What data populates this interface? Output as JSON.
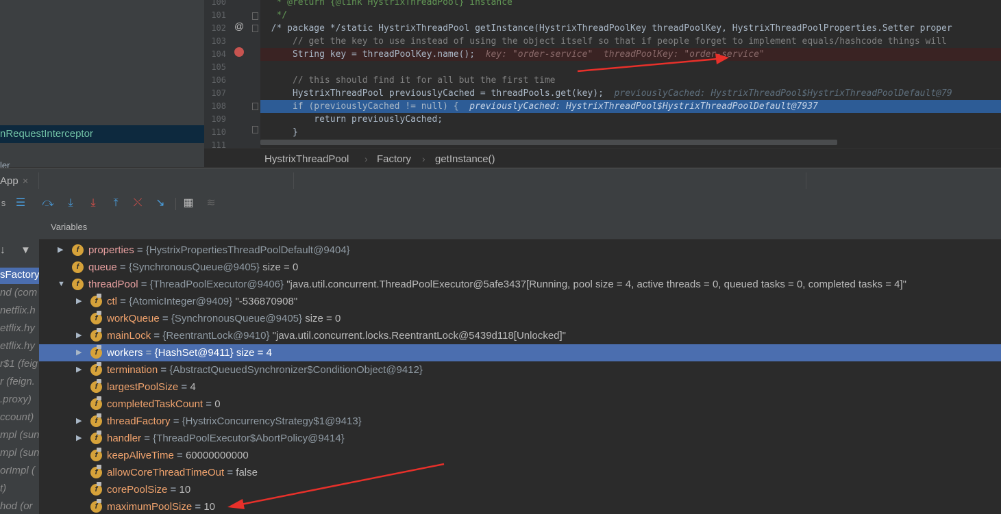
{
  "project_pane": {
    "selected_item": "nRequestInterceptor",
    "cut_item": "ler"
  },
  "editor": {
    "lines": [
      {
        "num": "100",
        "text": " * @return {@link HystrixThreadPool} instance"
      },
      {
        "num": "101",
        "text": " */"
      },
      {
        "num": "102",
        "text": "/* package */static HystrixThreadPool getInstance(HystrixThreadPoolKey threadPoolKey, HystrixThreadPoolProperties.Setter proper"
      },
      {
        "num": "103",
        "text": "    // get the key to use instead of using the object itself so that if people forget to implement equals/hashcode things will"
      },
      {
        "num": "104",
        "text": "    String key = threadPoolKey.name();",
        "hint": "key: \"order-service\"  threadPoolKey: \"order-service\""
      },
      {
        "num": "105",
        "text": ""
      },
      {
        "num": "106",
        "text": "    // this should find it for all but the first time"
      },
      {
        "num": "107",
        "text": "    HystrixThreadPool previouslyCached = threadPools.get(key);",
        "hint": "previouslyCached: HystrixThreadPool$HystrixThreadPoolDefault@79"
      },
      {
        "num": "108",
        "text": "    if (previouslyCached != null) {",
        "hint": "previouslyCached: HystrixThreadPool$HystrixThreadPoolDefault@7937"
      },
      {
        "num": "109",
        "text": "        return previouslyCached;"
      },
      {
        "num": "110",
        "text": "    }"
      },
      {
        "num": "111",
        "text": ""
      }
    ],
    "gutter_marks": {
      "at_symbol": "@"
    }
  },
  "breadcrumb": [
    "HystrixThreadPool",
    "Factory",
    "getInstance()"
  ],
  "debug": {
    "tab_label": "App",
    "tab_close": "×",
    "variables_header": "Variables",
    "left_frames": [
      "sFactory",
      "nd (com",
      "netflix.h",
      "etflix.hy",
      "etflix.hy",
      "r$1 (feig",
      "r (feign.",
      ".proxy)",
      "ccount)",
      "mpl (sun",
      "mpl (sun.",
      "orImpl (",
      "t)",
      "hod (or"
    ],
    "variables": [
      {
        "indent": 0,
        "expand": "▶",
        "name": "properties",
        "type": "{HystrixPropertiesThreadPoolDefault@9404}",
        "value": ""
      },
      {
        "indent": 0,
        "expand": "",
        "name": "queue",
        "type": "{SynchronousQueue@9405}",
        "value": " size = 0"
      },
      {
        "indent": 0,
        "expand": "▼",
        "name": "threadPool",
        "type": "{ThreadPoolExecutor@9406}",
        "value": "\"java.util.concurrent.ThreadPoolExecutor@5afe3437[Running, pool size = 4, active threads = 0, queued tasks = 0, completed tasks = 4]\""
      },
      {
        "indent": 1,
        "expand": "▶",
        "name": "ctl",
        "type": "{AtomicInteger@9409}",
        "value": "\"-536870908\""
      },
      {
        "indent": 1,
        "expand": "",
        "name": "workQueue",
        "type": "{SynchronousQueue@9405}",
        "value": " size = 0"
      },
      {
        "indent": 1,
        "expand": "▶",
        "name": "mainLock",
        "type": "{ReentrantLock@9410}",
        "value": "\"java.util.concurrent.locks.ReentrantLock@5439d118[Unlocked]\""
      },
      {
        "indent": 1,
        "expand": "▶",
        "name": "workers",
        "type": "{HashSet@9411}",
        "value": " size = 4",
        "selected": true
      },
      {
        "indent": 1,
        "expand": "▶",
        "name": "termination",
        "type": "{AbstractQueuedSynchronizer$ConditionObject@9412}",
        "value": ""
      },
      {
        "indent": 1,
        "expand": "",
        "name": "largestPoolSize",
        "type": "",
        "value": "4"
      },
      {
        "indent": 1,
        "expand": "",
        "name": "completedTaskCount",
        "type": "",
        "value": "0"
      },
      {
        "indent": 1,
        "expand": "▶",
        "name": "threadFactory",
        "type": "{HystrixConcurrencyStrategy$1@9413}",
        "value": ""
      },
      {
        "indent": 1,
        "expand": "▶",
        "name": "handler",
        "type": "{ThreadPoolExecutor$AbortPolicy@9414}",
        "value": ""
      },
      {
        "indent": 1,
        "expand": "",
        "name": "keepAliveTime",
        "type": "",
        "value": "60000000000"
      },
      {
        "indent": 1,
        "expand": "",
        "name": "allowCoreThreadTimeOut",
        "type": "",
        "value": "false"
      },
      {
        "indent": 1,
        "expand": "",
        "name": "corePoolSize",
        "type": "",
        "value": "10"
      },
      {
        "indent": 1,
        "expand": "",
        "name": "maximumPoolSize",
        "type": "",
        "value": "10"
      }
    ]
  },
  "colors": {
    "editor_bg": "#2b2b2b",
    "panel_bg": "#3c3f41",
    "selection": "#4b6eaf",
    "annotation_arrow": "#e8302a"
  }
}
